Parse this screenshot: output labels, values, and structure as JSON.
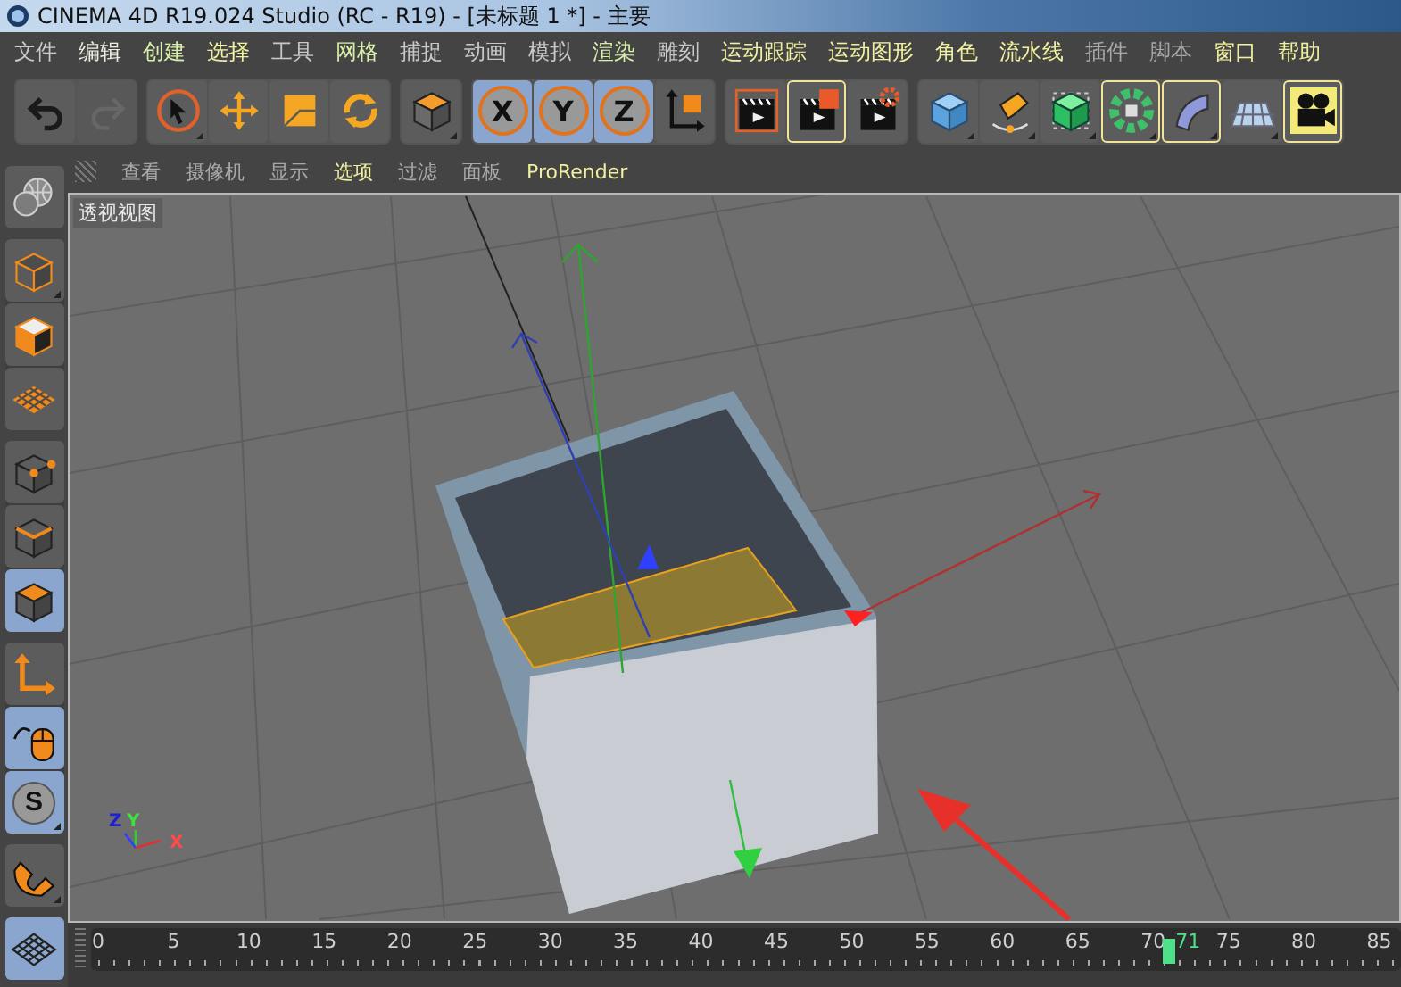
{
  "window": {
    "title": "CINEMA 4D R19.024 Studio (RC - R19) - [未标题 1 *] - 主要"
  },
  "menu": [
    {
      "label": "文件",
      "color": "#c8c8c8"
    },
    {
      "label": "编辑",
      "color": "#ecece0"
    },
    {
      "label": "创建",
      "color": "#d8f0a8"
    },
    {
      "label": "选择",
      "color": "#f0f0a0"
    },
    {
      "label": "工具",
      "color": "#c8c8c8"
    },
    {
      "label": "网格",
      "color": "#d8f0a8"
    },
    {
      "label": "捕捉",
      "color": "#c8c8c8"
    },
    {
      "label": "动画",
      "color": "#c8c8c8"
    },
    {
      "label": "模拟",
      "color": "#c8c8c8"
    },
    {
      "label": "渲染",
      "color": "#d8f0a8"
    },
    {
      "label": "雕刻",
      "color": "#c8c8c8"
    },
    {
      "label": "运动跟踪",
      "color": "#f0f0a0"
    },
    {
      "label": "运动图形",
      "color": "#f0f0a0"
    },
    {
      "label": "角色",
      "color": "#f0f0a0"
    },
    {
      "label": "流水线",
      "color": "#f0f0a0"
    },
    {
      "label": "插件",
      "color": "#a8a8a8"
    },
    {
      "label": "脚本",
      "color": "#a8a8a8"
    },
    {
      "label": "窗口",
      "color": "#f0f0a0"
    },
    {
      "label": "帮助",
      "color": "#f0f0a0"
    }
  ],
  "toolbar": {
    "groups": [
      {
        "buttons": [
          {
            "selected": false,
            "highlighted": false,
            "disabled": false,
            "submenu": false
          },
          {
            "selected": false,
            "highlighted": false,
            "disabled": true,
            "submenu": false
          }
        ]
      },
      {
        "buttons": [
          {
            "selected": false,
            "highlighted": false,
            "disabled": false,
            "submenu": true
          },
          {
            "selected": false,
            "highlighted": false,
            "disabled": false,
            "submenu": false
          },
          {
            "selected": false,
            "highlighted": false,
            "disabled": false,
            "submenu": false
          },
          {
            "selected": false,
            "highlighted": false,
            "disabled": false,
            "submenu": false
          }
        ]
      },
      {
        "buttons": [
          {
            "selected": false,
            "highlighted": false,
            "disabled": false,
            "submenu": true
          }
        ]
      },
      {
        "buttons": [
          {
            "label": "X",
            "selected": true,
            "highlighted": false,
            "disabled": false,
            "submenu": false
          },
          {
            "label": "Y",
            "selected": true,
            "highlighted": false,
            "disabled": false,
            "submenu": false
          },
          {
            "label": "Z",
            "selected": true,
            "highlighted": false,
            "disabled": false,
            "submenu": false
          },
          {
            "selected": false,
            "highlighted": false,
            "disabled": false,
            "submenu": false
          }
        ]
      },
      {
        "buttons": [
          {
            "selected": false,
            "highlighted": false,
            "disabled": false,
            "submenu": false
          },
          {
            "selected": false,
            "highlighted": true,
            "disabled": false,
            "submenu": false
          },
          {
            "selected": false,
            "highlighted": false,
            "disabled": false,
            "submenu": false
          }
        ]
      },
      {
        "buttons": [
          {
            "selected": false,
            "highlighted": false,
            "disabled": false,
            "submenu": true
          },
          {
            "selected": false,
            "highlighted": false,
            "disabled": false,
            "submenu": true
          },
          {
            "selected": false,
            "highlighted": false,
            "disabled": false,
            "submenu": true
          },
          {
            "selected": false,
            "highlighted": true,
            "disabled": false,
            "submenu": true
          },
          {
            "selected": false,
            "highlighted": true,
            "disabled": false,
            "submenu": true
          },
          {
            "selected": false,
            "highlighted": false,
            "disabled": false,
            "submenu": true
          },
          {
            "selected": false,
            "highlighted": true,
            "disabled": false,
            "submenu": false
          }
        ]
      }
    ]
  },
  "sidebar": {
    "groups": [
      {
        "buttons": [
          {
            "selected": false,
            "submenu": false
          }
        ]
      },
      {
        "buttons": [
          {
            "selected": false,
            "submenu": true
          },
          {
            "selected": false,
            "submenu": false
          },
          {
            "selected": false,
            "submenu": false
          }
        ]
      },
      {
        "buttons": [
          {
            "selected": false,
            "submenu": false
          },
          {
            "selected": false,
            "submenu": false
          },
          {
            "selected": true,
            "submenu": false
          }
        ]
      },
      {
        "buttons": [
          {
            "selected": false,
            "submenu": false
          },
          {
            "selected": true,
            "submenu": false
          },
          {
            "label": "S",
            "selected": true,
            "submenu": true
          }
        ]
      },
      {
        "buttons": [
          {
            "selected": false,
            "submenu": true
          }
        ]
      },
      {
        "buttons": [
          {
            "selected": true,
            "submenu": false
          }
        ]
      }
    ]
  },
  "viewport": {
    "menu": [
      {
        "label": "查看",
        "color": "#a8a8a8"
      },
      {
        "label": "摄像机",
        "color": "#a8a8a8"
      },
      {
        "label": "显示",
        "color": "#a8a8a8"
      },
      {
        "label": "选项",
        "color": "#f0f0a0"
      },
      {
        "label": "过滤",
        "color": "#a8a8a8"
      },
      {
        "label": "面板",
        "color": "#a8a8a8"
      },
      {
        "label": "ProRender",
        "color": "#f0f0a0"
      }
    ],
    "view_label": "透视视图",
    "axis_labels": [
      "Z",
      "Y",
      "X"
    ]
  },
  "timeline": {
    "ticks": [
      "0",
      "5",
      "10",
      "15",
      "20",
      "25",
      "30",
      "35",
      "40",
      "45",
      "50",
      "55",
      "60",
      "65",
      "70",
      "75",
      "80",
      "85"
    ],
    "current_frame": "71",
    "level": 0.789
  }
}
